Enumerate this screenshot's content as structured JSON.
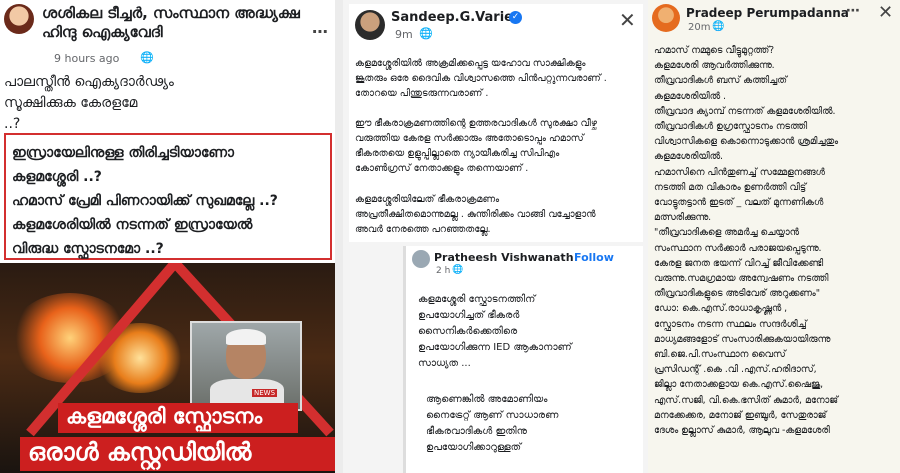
{
  "post1": {
    "author": "ശശികല ടീച്ചർ, സംസ്ഥാന അദ്ധ്യക്ഷ ഹിന്ദു ഐക്യവേദി",
    "time": "9 hours ago",
    "body": "പാലസ്തീൻ ഐക്യദാർഢ്യം\nസൂക്ഷിക്കുക കേരളമേ\n         ..?",
    "box_text": "ഇസ്രായേലിനുള്ള തിരിച്ചടിയാണോ\nകളമശ്ശേരി ..?\nഹമാസ് പ്രേമി പിണറായിക്ക് സുഖമല്ലേ ..?\nകളമശേരിയിൽ നടന്നത് ഇസ്രായേൽ\nവിരുദ്ധ സ്ഫോടനമോ ..?",
    "caption_line1": "കളമശ്ശേരി സ്ഫോടനം",
    "caption_line2": "ഒരാൾ കസ്റ്റഡിയിൽ",
    "news_tag": "NEWS"
  },
  "post2": {
    "author": "Sandeep.G.Varier",
    "time": "9m",
    "para1": "കളമശ്ശേരിയിൽ അക്രമിക്കപ്പെട്ട യഹോവ സാക്ഷികളും\nജൂതരും ഒരേ ദൈവിക വിശ്വാസത്തെ പിൻപറ്റുന്നവരാണ് .\nതോറയെ പിന്തുടരുന്നവരാണ് .",
    "para2": "ഈ ഭീകരാക്രമണത്തിന്റെ ഉത്തരവാദികൾ സുരക്ഷാ വീഴ്ച\nവരുത്തിയ കേരള സർക്കാരും അതോടൊപ്പം ഹമാസ്\nഭീകരതയെ ഉളുപ്പില്ലാതെ ന്യായീകരിച്ച സിപിഎം\nകോൺഗ്രസ് നേതാക്കളും തന്നെയാണ് .",
    "para3": "കളമശ്ശേരിയിലേത് ഭീകരാക്രമണം\nഅപ്രതീക്ഷിതമൊന്നുമല്ല . കുന്തിരിക്കം വാങ്ങി വച്ചോളാൻ\nഅവർ നേരത്തെ പറഞ്ഞതല്ലേ."
  },
  "post2b": {
    "author": "Pratheesh Vishwanath",
    "follow_label": "Follow",
    "time": "2 h",
    "para1": "കളമശ്ശേരി സ്ഫോടനത്തിന്\nഉപയോഗിച്ചത് ഭീകരർ\nസൈനികർക്കെതിരെ\nഉപയോഗിക്കുന്ന IED ആകാനാണ്\nസാധ്യത ...",
    "para2": "ആണെങ്കിൽ അമോണിയം\nനൈട്രേറ്റ് ആണ് സാധാരണ\nഭീകരവാദികൾ ഇതിനു\nഉപയോഗിക്കാറുള്ളത്"
  },
  "post3": {
    "author": "Pradeep Perumpadanna",
    "time": "20m",
    "body": "ഹമാസ് നമ്മുടെ വീട്ടുമുറ്റത്ത്?\nകളമശേരി ആവർത്തിക്കുന്നു.\nതീവ്രവാദികൾ ബസ് കത്തിച്ചത്\nകളമശേരിയിൽ .\nതീവ്രവാദ ക്യാമ്പ് നടന്നത് കളമശേരിയിൽ.\nതീവ്രവാദികൾ ഉഗ്രസ്ഫോടനം നടത്തി\nവിശ്വാസികളെ കൊന്നൊടുക്കാൻ ശ്രമിച്ചതും\nകളമശേരിയിൽ.\nഹമാസിനെ പിൻതുണച്ച് സമ്മേളനങ്ങൾ\nനടത്തി മത വികാരം ഉണർത്തി വിട്ട്\nവോട്ടുതട്ടാൻ ഇടത് _ വലത് മുന്നണികൾ\nമത്സരിക്കുന്നു.\n\"തീവ്രവാദികളെ അമർച്ച ചെയ്യാൻ\nസംസ്ഥാന സർക്കാർ പരാജയപ്പെടുന്നു.\nകേരള ജനത ഭയന്ന് വിറച്ച് ജീവിക്കേണ്ടി\nവരുന്നു.സമഗ്രമായ അന്വേഷണം നടത്തി\nതീവ്രവാദികളുടെ അടിവേര് അറുക്കണം\"\nഡോ: കെ.എസ്.രാധാകൃഷ്ണൻ ,\nസ്ഫോടനം നടന്ന സ്ഥലം സന്ദർശിച്ച്\nമാധ്യമങ്ങളോട് സംസാരിക്കുകയായിരുന്നു\nബി.ജെ.പി.സംസ്ഥാന വൈസ്\nപ്രസിഡന്റ് .കെ .വി .എസ്.ഹരിദാസ്,\nജില്ലാ നേതാക്കളായ കെ.എസ്.ഷൈജു,\nഎസ്.സജി, വി.കെ.ഭസിത് കുമാർ, മനോജ്\nമനക്കേക്കര, മനോജ് ഇഞ്ചൂർ, സേതുരാജ്\nദേശം ഉല്ലാസ് കുമാർ, ആലുവ -കളമശേരി"
  },
  "colors": {
    "accent": "#1877f2",
    "box_border": "#d32f2f",
    "caption_bg": "#cc1f1f",
    "fire": "#e8621a"
  }
}
